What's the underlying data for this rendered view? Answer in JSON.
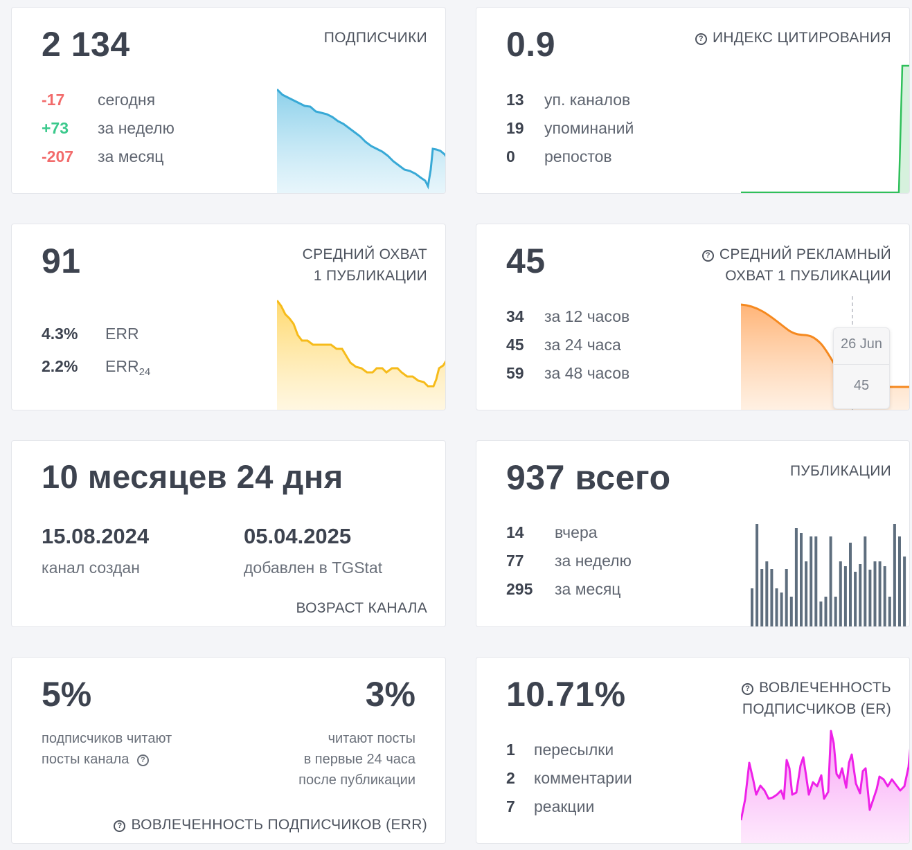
{
  "subscribers": {
    "value": "2 134",
    "label": "ПОДПИСЧИКИ",
    "rows": [
      {
        "num": "-17",
        "text": "сегодня"
      },
      {
        "num": "+73",
        "text": "за неделю"
      },
      {
        "num": "-207",
        "text": "за месяц"
      }
    ],
    "color": "#38a9d6"
  },
  "citation": {
    "value": "0.9",
    "label": "ИНДЕКС ЦИТИРОВАНИЯ",
    "rows": [
      {
        "num": "13",
        "text": "уп. каналов"
      },
      {
        "num": "19",
        "text": "упоминаний"
      },
      {
        "num": "0",
        "text": "репостов"
      }
    ],
    "color": "#2fbf5a"
  },
  "reach": {
    "value": "91",
    "label_line1": "СРЕДНИЙ ОХВАТ",
    "label_line2": "1 ПУБЛИКАЦИИ",
    "rows": [
      {
        "num": "4.3%",
        "text": "ERR",
        "sub": ""
      },
      {
        "num": "2.2%",
        "text": "ERR",
        "sub": "24"
      }
    ],
    "color": "#f6bb1a"
  },
  "ad_reach": {
    "value": "45",
    "label_line1": "СРЕДНИЙ РЕКЛАМНЫЙ",
    "label_line2": "ОХВАТ 1 ПУБЛИКАЦИИ",
    "rows": [
      {
        "num": "34",
        "text": "за 12 часов"
      },
      {
        "num": "45",
        "text": "за 24 часа"
      },
      {
        "num": "59",
        "text": "за 48 часов"
      }
    ],
    "tooltip": {
      "date": "26 Jun",
      "value": "45"
    },
    "color": "#f5891f"
  },
  "age": {
    "value": "10 месяцев 24 дня",
    "created_date": "15.08.2024",
    "created_label": "канал создан",
    "added_date": "05.04.2025",
    "added_label": "добавлен в TGStat",
    "label": "ВОЗРАСТ КАНАЛА"
  },
  "publications": {
    "value": "937 всего",
    "label": "ПУБЛИКАЦИИ",
    "rows": [
      {
        "num": "14",
        "text": "вчера"
      },
      {
        "num": "77",
        "text": "за неделю"
      },
      {
        "num": "295",
        "text": "за месяц"
      }
    ],
    "color": "#5e6e7e"
  },
  "err_card": {
    "left_value": "5%",
    "left_line1": "подписчиков читают",
    "left_line2": "посты канала",
    "right_value": "3%",
    "right_line1": "читают посты",
    "right_line2": "в первые 24 часа",
    "right_line3": "после публикации",
    "label": "ВОВЛЕЧЕННОСТЬ ПОДПИСЧИКОВ (ERR)"
  },
  "er_card": {
    "value": "10.71%",
    "label_line1": "ВОВЛЕЧЕННОСТЬ",
    "label_line2": "ПОДПИСЧИКОВ (ER)",
    "rows": [
      {
        "num": "1",
        "text": "пересылки"
      },
      {
        "num": "2",
        "text": "комментарии"
      },
      {
        "num": "7",
        "text": "реакции"
      }
    ],
    "color": "#ee22e8"
  },
  "icons": {
    "question": "?"
  }
}
